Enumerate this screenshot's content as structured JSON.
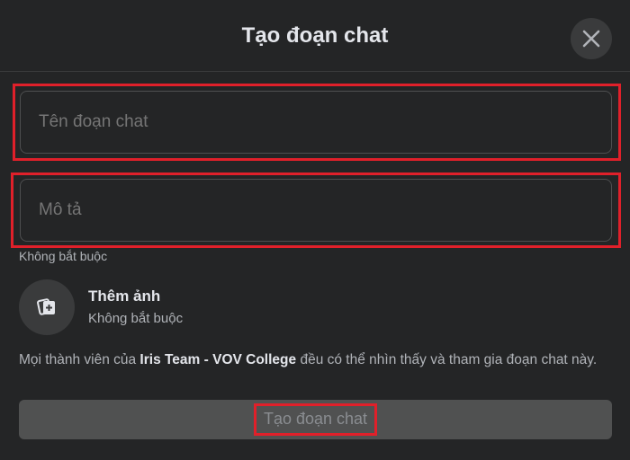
{
  "dialog": {
    "title": "Tạo đoạn chat",
    "close_icon": "close-icon"
  },
  "form": {
    "name_placeholder": "Tên đoạn chat",
    "description_placeholder": "Mô tả",
    "optional_hint": "Không bắt buộc"
  },
  "photo": {
    "icon": "add-photo-icon",
    "title": "Thêm ảnh",
    "subtitle": "Không bắt buộc"
  },
  "notice": {
    "prefix": "Mọi thành viên của ",
    "group_name": "Iris Team - VOV College",
    "suffix": " đều có thể nhìn thấy và tham gia đoạn chat này."
  },
  "submit": {
    "label": "Tạo đoạn chat"
  },
  "colors": {
    "highlight": "#e0202a",
    "background": "#242526",
    "button_disabled": "#505151"
  }
}
